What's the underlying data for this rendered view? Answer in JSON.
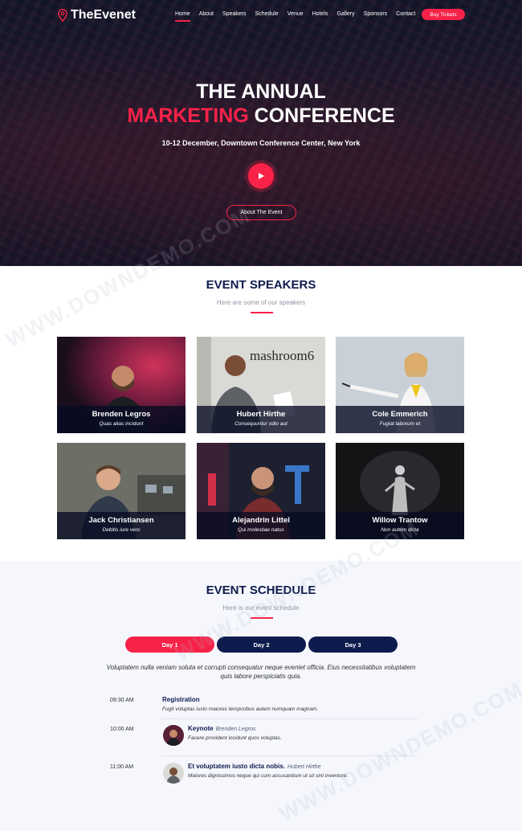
{
  "header": {
    "logo_text": "TheEvenet",
    "nav": [
      "Home",
      "About",
      "Speakers",
      "Schedule",
      "Venue",
      "Hotels",
      "Gallery",
      "Sponsors",
      "Contact"
    ],
    "buy_label": "Buy Tickets"
  },
  "hero": {
    "line1": "THE ANNUAL",
    "line2_accent": "MARKETING",
    "line2_rest": " CONFERENCE",
    "subtitle": "10-12 December, Downtown Conference Center, New York",
    "about_label": "About The Event"
  },
  "speakers": {
    "title": "EVENT SPEAKERS",
    "subtitle": "Here are some of our speakers",
    "items": [
      {
        "name": "Brenden Legros",
        "role": "Quas alias incidunt"
      },
      {
        "name": "Hubert Hirthe",
        "role": "Consequuntur odio aut"
      },
      {
        "name": "Cole Emmerich",
        "role": "Fugiat laborum et"
      },
      {
        "name": "Jack Christiansen",
        "role": "Debitis iure vero"
      },
      {
        "name": "Alejandrin Littel",
        "role": "Qui molestiae natus"
      },
      {
        "name": "Willow Trantow",
        "role": "Non autem dicta"
      }
    ],
    "photo_sign_text": "mashroom6"
  },
  "schedule": {
    "title": "EVENT SCHEDULE",
    "subtitle": "Here is our event schedule",
    "days": [
      "Day 1",
      "Day 2",
      "Day 3"
    ],
    "intro": "Voluptatem nulla veniam soluta et corrupti consequatur neque eveniet officia. Eius necessitatibus voluptatem quis labore perspiciatis quia.",
    "items": [
      {
        "time": "09:30 AM",
        "title": "Registration",
        "speaker": "",
        "desc": "Fugit voluptas iusto maiores temporibus autem numquam magnam."
      },
      {
        "time": "10:00 AM",
        "title": "Keynote",
        "speaker": "Brenden Legros",
        "desc": "Facere provident incidunt quos voluptas."
      },
      {
        "time": "11:00 AM",
        "title": "Et voluptatem iusto dicta nobis.",
        "speaker": "Hubert Hirthe",
        "desc": "Maiores dignissimos neque qui cum accusantium ut sit sint inventore."
      }
    ]
  },
  "watermark": "WWW.DOWNDEMO.COM",
  "colors": {
    "accent": "#f82249",
    "navy": "#0e1b4d"
  }
}
